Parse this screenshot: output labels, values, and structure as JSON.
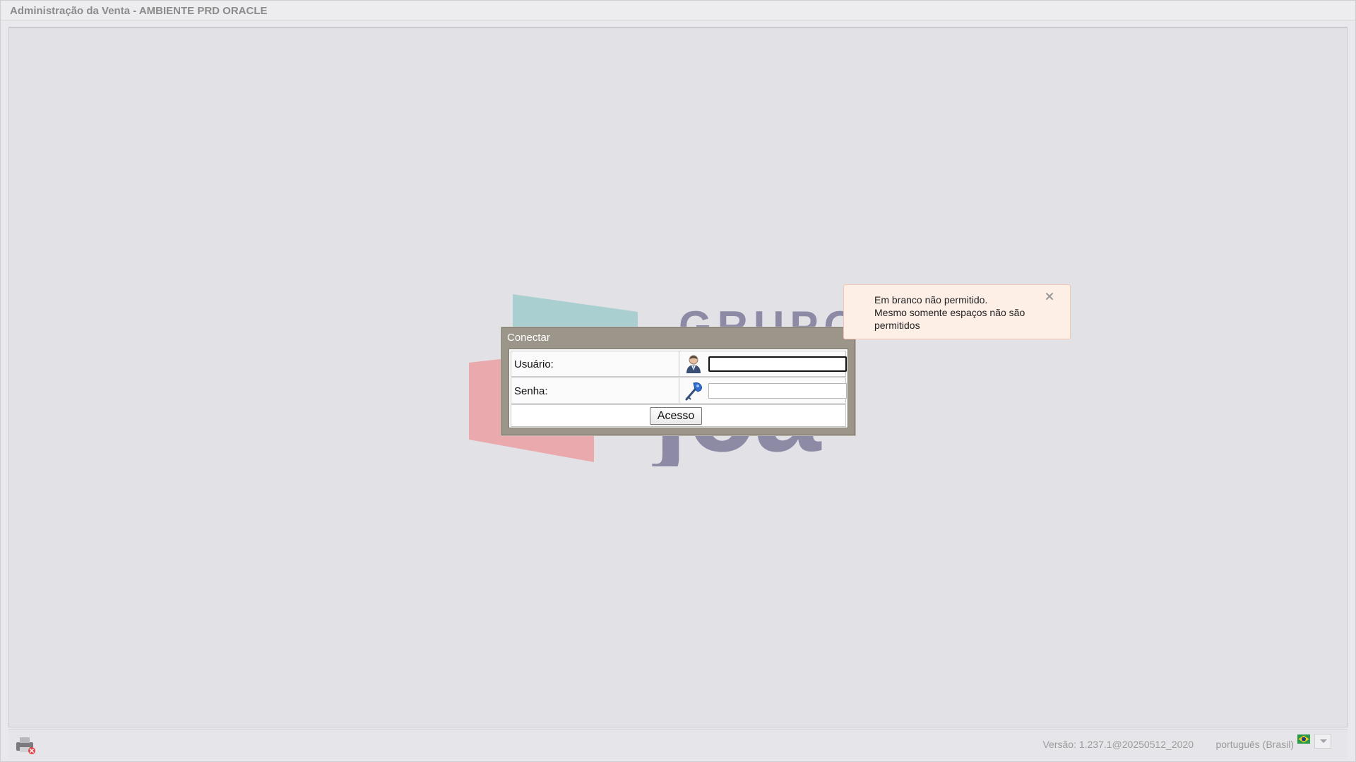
{
  "window": {
    "title": "Administração da Venta - AMBIENTE PRD ORACLE"
  },
  "login": {
    "title": "Conectar",
    "user_label": "Usuário:",
    "user_value": "",
    "user_icon": "user-icon",
    "password_label": "Senha:",
    "password_value": "",
    "password_icon": "key-icon",
    "access_label": "Acesso"
  },
  "toast": {
    "line1": "Em branco não permitido.",
    "line2": "Mesmo somente espaços não são permitidos",
    "close_label": "×"
  },
  "footer": {
    "version": "Versão: 1.237.1@20250512_2020",
    "language": "português (Brasil)",
    "printer_icon": "printer-error-icon",
    "flag_icon": "brazil-flag-icon"
  },
  "colors": {
    "dialog_header": "#9c958a",
    "toast_bg": "#fdeee6",
    "logo_teal": "#a9cfd0",
    "logo_red": "#e9a9ad",
    "logo_navy": "#8d8aa6"
  }
}
